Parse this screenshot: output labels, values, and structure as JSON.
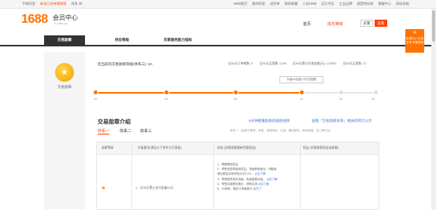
{
  "topbar": {
    "items": [
      "手机阿里",
      "本站已支持简体版",
      "消息 35",
      "1688首页",
      "我的阿里",
      "进货单",
      "我的收藏",
      "入驻1688",
      "买方专区",
      "工业品牌",
      "我是供应商",
      "客服中心",
      "网站导航"
    ]
  },
  "header": {
    "logo": "1688",
    "title": "会员中心",
    "subtitle": "by 1688.com",
    "nav_home": "首页",
    "nav_level": "成长等级",
    "btn_buyer": "买家",
    "btn_seller": "卖家"
  },
  "tabs": [
    "交易勋章",
    "供应等级",
    "买家服务能力指标"
  ],
  "left": {
    "badge_label": "交易勋章",
    "badge_glyph": "★"
  },
  "stats": {
    "title": "您当前的交易勋章等级(体系三): 3A",
    "s1": "近90天订单笔数: 0",
    "s2": "近90天买家数: 0.0%",
    "s3": "近90天累计交易金额(元): 175397",
    "s4": "近90天买家数: 27"
  },
  "tooltip": "升级4A还差2.5万交易额",
  "levels": [
    "1A",
    "2A",
    "3A",
    "4A",
    "5A",
    "6A"
  ],
  "section": {
    "title": "交易勋章介绍",
    "link1": "5分钟看懂勋章新规则视频",
    "link2": "查看「交易勋章体系」相关的转订公示",
    "system_tabs": [
      "体系一",
      "体系二",
      "体系三"
    ],
    "system_desc": "体系一：(适用于服饰、家居、母婴用品、日用、箱包配饰、家纺家装、化工等行业)"
  },
  "table": {
    "headers": [
      "勋章等级",
      "升级要求(满足以下条件方可晋级)",
      "权益 (如需查看最新完整权益)",
      "权益 (如需查看权益请查看)"
    ],
    "requirement": "1、近30天累计支付金额≥0元",
    "rights": [
      {
        "text": "1、需要基础权益",
        "link": ""
      },
      {
        "text": "2、享受该勋章级别权益，快速获取营业、领取新",
        "link": ""
      },
      {
        "text": "   营业额及买家体验分达0.2%。",
        "link": "点这了解"
      },
      {
        "text": "3、享受勋章相关流量，免费客服对接。",
        "link": "点这了解"
      },
      {
        "text": "4、享受店铺首页展示，获取实惠",
        "link": "点这了解"
      },
      {
        "text": "5、1A商家，确定订单营销与",
        "link": "会员了"
      }
    ]
  },
  "side_float": "客服中心 在线咨询 专属客服"
}
